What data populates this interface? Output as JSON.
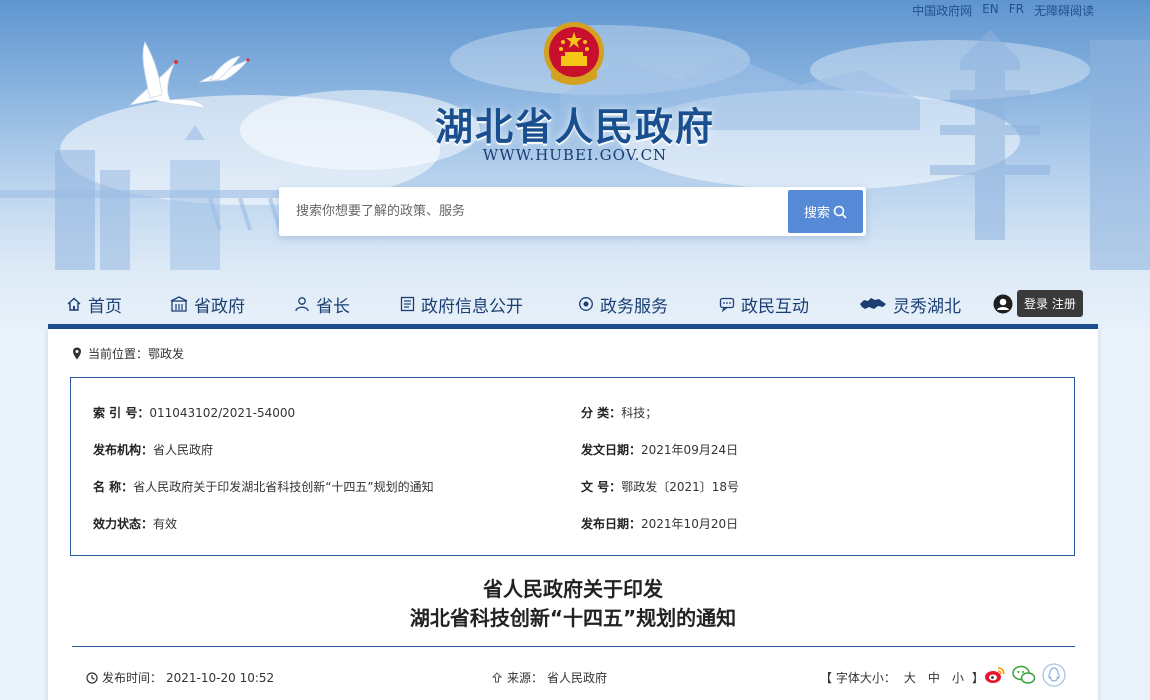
{
  "toplinks": [
    "中国政府网",
    "EN",
    "FR",
    "无障碍阅读"
  ],
  "header": {
    "title": "湖北省人民政府",
    "url": "WWW.HUBEI.GOV.CN"
  },
  "search": {
    "placeholder": "搜索你想要了解的政策、服务",
    "button_label": "搜索"
  },
  "nav": {
    "items": [
      {
        "label": "首页",
        "icon": "home-icon"
      },
      {
        "label": "省政府",
        "icon": "building-icon"
      },
      {
        "label": "省长",
        "icon": "person-icon"
      },
      {
        "label": "政府信息公开",
        "icon": "document-icon"
      },
      {
        "label": "政务服务",
        "icon": "service-icon"
      },
      {
        "label": "政民互动",
        "icon": "chat-icon"
      },
      {
        "label": "灵秀湖北",
        "icon": "hubei-map-icon"
      }
    ],
    "login_label": "登录 注册"
  },
  "breadcrumb": {
    "label": "当前位置：",
    "current": "鄂政发"
  },
  "meta": {
    "index_label": "索 引 号：",
    "index_value": "011043102/2021-54000",
    "category_label": "分 类：",
    "category_value": "科技；",
    "issuer_label": "发布机构：",
    "issuer_value": "省人民政府",
    "doc_date_label": "发文日期：",
    "doc_date_value": "2021年09月24日",
    "name_label": "名 称：",
    "name_value": "省人民政府关于印发湖北省科技创新“十四五”规划的通知",
    "doc_no_label": "文 号：",
    "doc_no_value": "鄂政发〔2021〕18号",
    "status_label": "效力状态：",
    "status_value": "有效",
    "publish_date_label": "发布日期：",
    "publish_date_value": "2021年10月20日"
  },
  "document": {
    "title_line1": "省人民政府关于印发",
    "title_line2": "湖北省科技创新“十四五”规划的通知",
    "publish_time_label": "发布时间：",
    "publish_time_value": "2021-10-20 10:52",
    "source_label": "来源：",
    "source_value": "省人民政府",
    "font_size_label": "【 字体大小：",
    "font_size_end": "】",
    "font_sizes": [
      "大",
      "中",
      "小"
    ]
  },
  "colors": {
    "nav_text": "#1b3f73",
    "accent_blue": "#1d4f93",
    "search_button": "#5689d6",
    "title_blue": "#1a4f8f"
  }
}
